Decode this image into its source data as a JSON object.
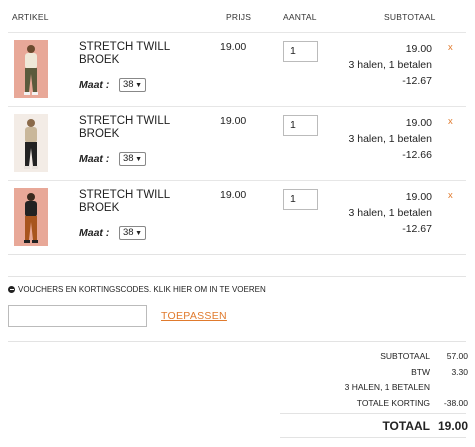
{
  "table_header": {
    "artikel": "ARTIKEL",
    "prijs": "PRIJS",
    "aantal": "AANTAL",
    "subtotaal": "SUBTOTAAL"
  },
  "items": [
    {
      "name": "STRETCH TWILL BROEK",
      "maat_label": "Maat :",
      "size": "38",
      "price": "19.00",
      "quantity": "1",
      "subtotal": "19.00",
      "promo": "3 halen, 1 betalen",
      "discount": "-12.67",
      "remove": "x",
      "pants_color": "#5b5a3c"
    },
    {
      "name": "STRETCH TWILL BROEK",
      "maat_label": "Maat :",
      "size": "38",
      "price": "19.00",
      "quantity": "1",
      "subtotal": "19.00",
      "promo": "3 halen, 1 betalen",
      "discount": "-12.66",
      "remove": "x",
      "pants_color": "#222222"
    },
    {
      "name": "STRETCH TWILL BROEK",
      "maat_label": "Maat :",
      "size": "38",
      "price": "19.00",
      "quantity": "1",
      "subtotal": "19.00",
      "promo": "3 halen, 1 betalen",
      "discount": "-12.67",
      "remove": "x",
      "pants_color": "#a8551e"
    }
  ],
  "voucher": {
    "toggle_text": "VOUCHERS EN KORTINGSCODES. KLIK HIER OM IN TE VOEREN",
    "input_value": "",
    "apply_label": "TOEPASSEN"
  },
  "totals": {
    "subtotaal_label": "SUBTOTAAL",
    "subtotaal_value": "57.00",
    "btw_label": "BTW",
    "btw_value": "3.30",
    "promo_label": "3 HALEN, 1 BETALEN",
    "korting_label": "TOTALE KORTING",
    "korting_value": "-38.00",
    "totaal_label": "TOTAAL",
    "totaal_value": "19.00"
  },
  "colors": {
    "accent": "#e07a2d",
    "photo_background": "#e8a898"
  }
}
